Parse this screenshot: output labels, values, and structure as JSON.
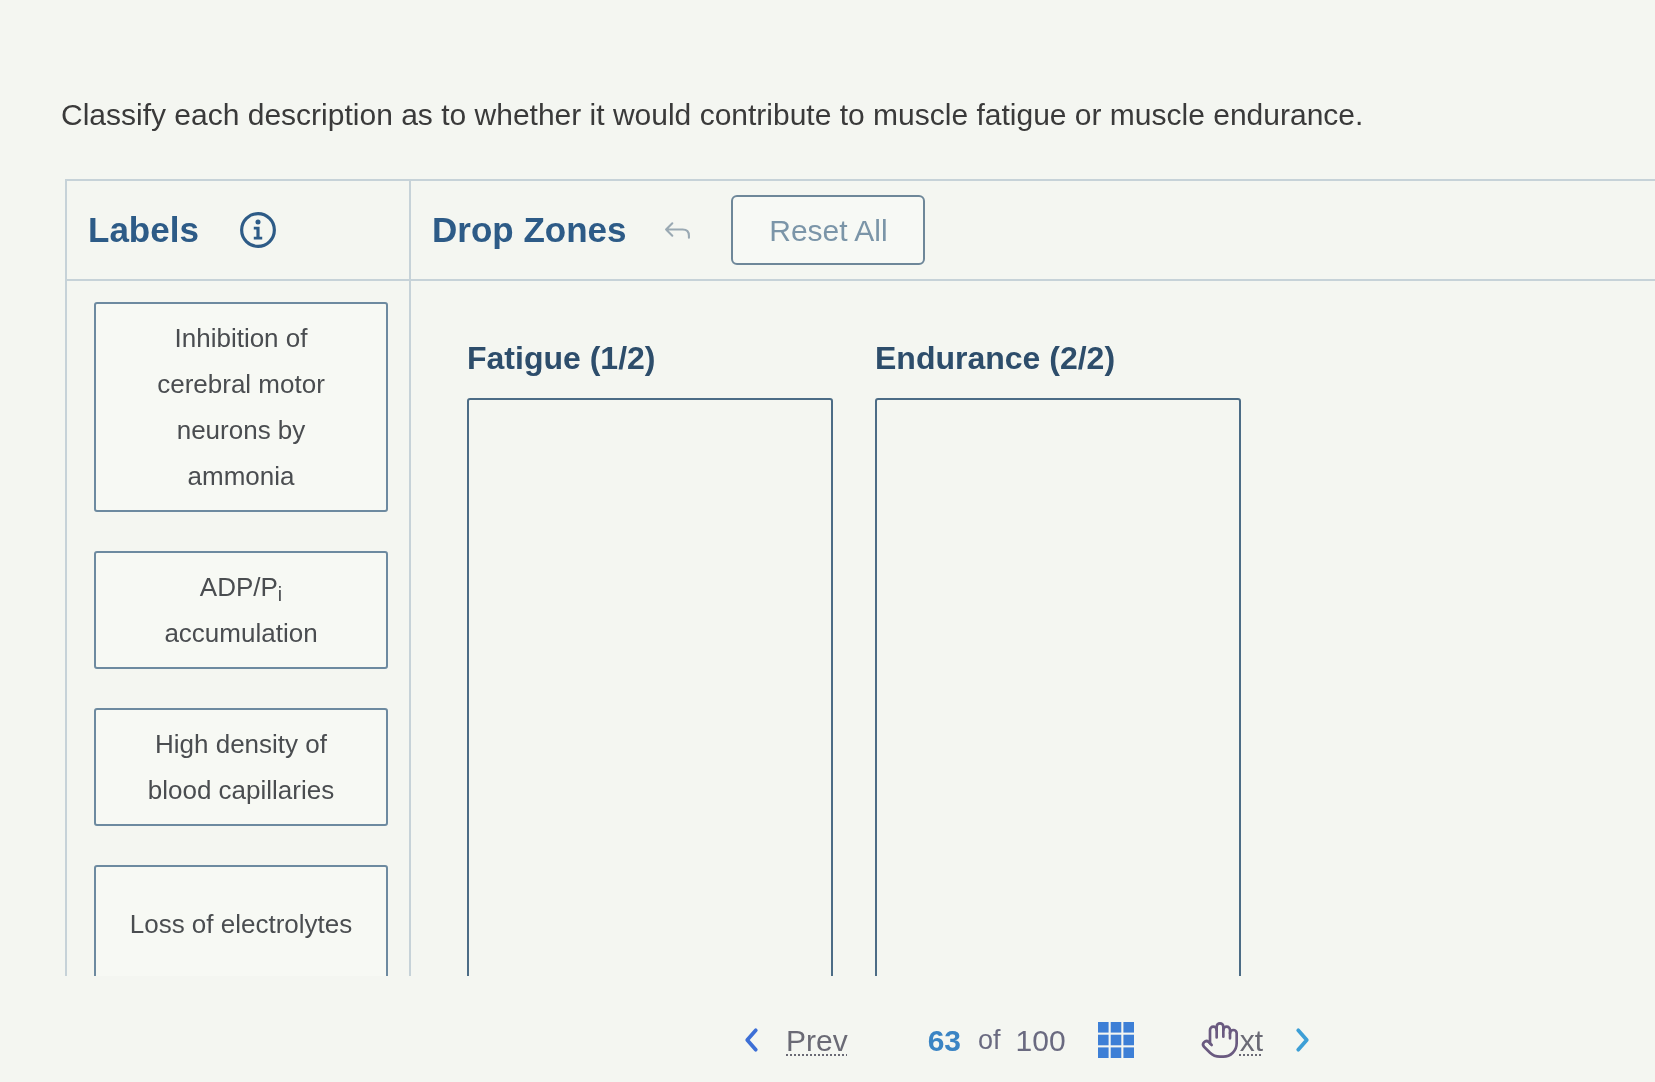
{
  "question": "Classify each description as to whether it would contribute to muscle fatigue or muscle endurance.",
  "labels_panel": {
    "title": "Labels",
    "items": [
      {
        "text": "Inhibition of cerebral motor neurons by ammonia"
      },
      {
        "text": "ADP/P$_{i}$ accumulation"
      },
      {
        "text": "High density of blood capillaries"
      },
      {
        "text": "Loss of electrolytes"
      }
    ]
  },
  "drop_zones_panel": {
    "title": "Drop Zones",
    "reset_button": "Reset All",
    "zones": [
      {
        "title": "Fatigue (1/2)"
      },
      {
        "title": "Endurance (2/2)"
      }
    ]
  },
  "navigation": {
    "prev": "Prev",
    "current": "63",
    "of": "of",
    "total": "100",
    "next": "xt"
  }
}
